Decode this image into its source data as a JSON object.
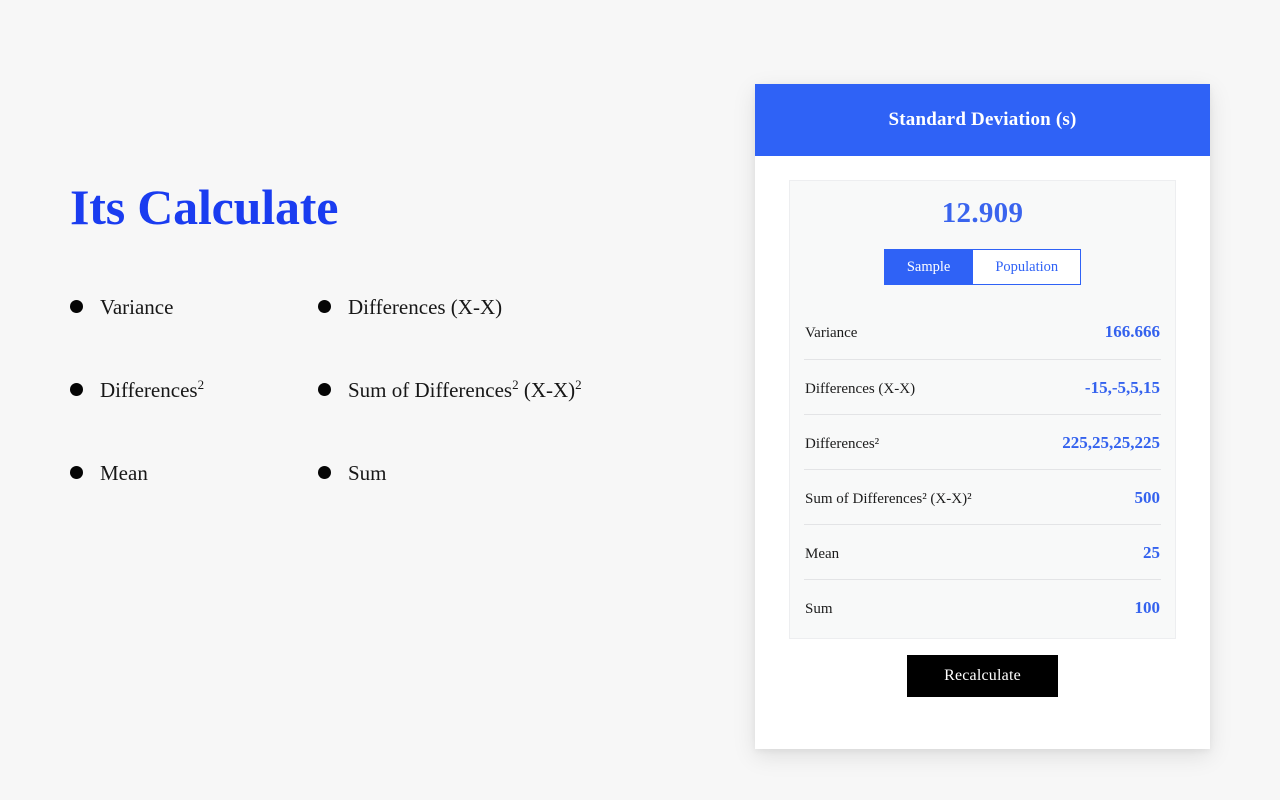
{
  "page": {
    "background_color": "#f7f7f7",
    "title": "Its Calculate",
    "title_color": "#1a3cf0"
  },
  "features": {
    "heading": "Its Calculate",
    "items": [
      {
        "label": "Variance",
        "sup": ""
      },
      {
        "label": "Differences (X-X)",
        "sup": ""
      },
      {
        "label": "Differences",
        "sup": "2"
      },
      {
        "label": "Sum of Differences",
        "sup": "2",
        "suffix": " (X-X)",
        "suffix_sup": "2"
      },
      {
        "label": "Mean",
        "sup": ""
      },
      {
        "label": "Sum",
        "sup": ""
      }
    ]
  },
  "card": {
    "header_title": "Standard Deviation (s)",
    "header_color": "#2f62f6",
    "result_value": "12.909",
    "result_color": "#3a64ee",
    "accent_color": "#2f62f6",
    "value_color": "#3462ee",
    "toggle": {
      "options": [
        "Sample",
        "Population"
      ],
      "selected": "Sample"
    },
    "stats": [
      {
        "label": "Variance",
        "value": "166.666"
      },
      {
        "label": "Differences (X-X)",
        "value": "-15,-5,5,15"
      },
      {
        "label": "Differences²",
        "value": "225,25,25,225"
      },
      {
        "label": "Sum of Differences² (X-X)²",
        "value": "500"
      },
      {
        "label": "Mean",
        "value": "25"
      },
      {
        "label": "Sum",
        "value": "100"
      }
    ],
    "recalculate_label": "Recalculate"
  }
}
